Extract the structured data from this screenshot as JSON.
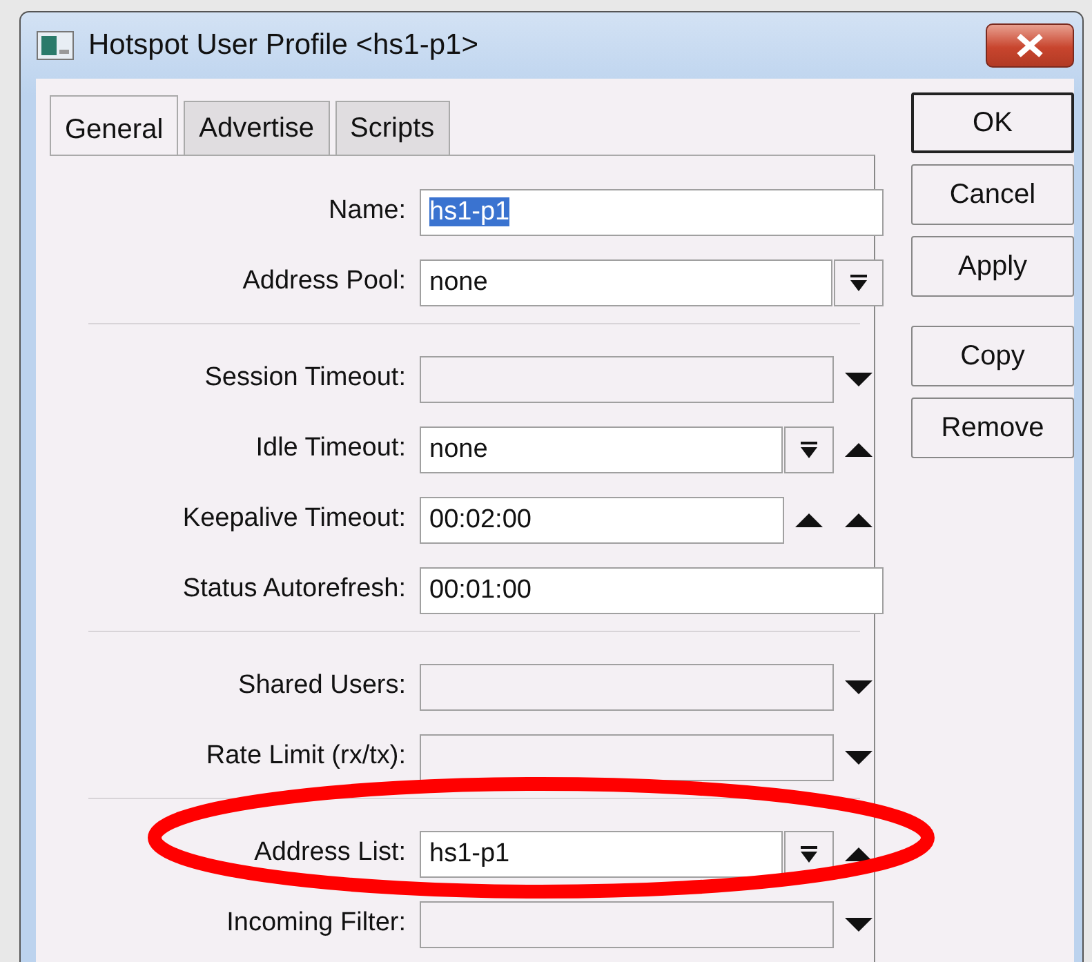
{
  "window": {
    "title": "Hotspot User Profile <hs1-p1>"
  },
  "tabs": [
    {
      "label": "General",
      "selected": true
    },
    {
      "label": "Advertise",
      "selected": false
    },
    {
      "label": "Scripts",
      "selected": false
    }
  ],
  "sections": [
    {
      "rows": [
        {
          "label": "Name:",
          "value": "hs1-p1",
          "value_selected": true,
          "controls": []
        },
        {
          "label": "Address Pool:",
          "value": "none",
          "controls": [
            {
              "kind": "menu"
            }
          ]
        }
      ]
    },
    {
      "rows": [
        {
          "label": "Session Timeout:",
          "controls": [
            {
              "kind": "down"
            }
          ]
        },
        {
          "label": "Idle Timeout:",
          "value": "none",
          "controls": [
            {
              "kind": "menu"
            },
            {
              "kind": "up"
            }
          ]
        },
        {
          "label": "Keepalive Timeout:",
          "value": "00:02:00",
          "controls": [
            {
              "kind": "up"
            },
            {
              "kind": "up"
            }
          ]
        },
        {
          "label": "Status Autorefresh:",
          "value": "00:01:00",
          "controls": []
        }
      ]
    },
    {
      "rows": [
        {
          "label": "Shared Users:",
          "controls": [
            {
              "kind": "down"
            }
          ]
        },
        {
          "label": "Rate Limit (rx/tx):",
          "controls": [
            {
              "kind": "down"
            }
          ]
        }
      ]
    },
    {
      "rows": [
        {
          "label": "Address List:",
          "value": "hs1-p1",
          "highlighted": true,
          "controls": [
            {
              "kind": "menu"
            },
            {
              "kind": "up"
            }
          ]
        },
        {
          "label": "Incoming Filter:",
          "controls": [
            {
              "kind": "down"
            }
          ]
        }
      ]
    }
  ],
  "button_groups": [
    [
      {
        "label": "OK",
        "default": true
      },
      {
        "label": "Cancel"
      },
      {
        "label": "Apply"
      }
    ],
    [
      {
        "label": "Copy"
      },
      {
        "label": "Remove"
      }
    ]
  ]
}
